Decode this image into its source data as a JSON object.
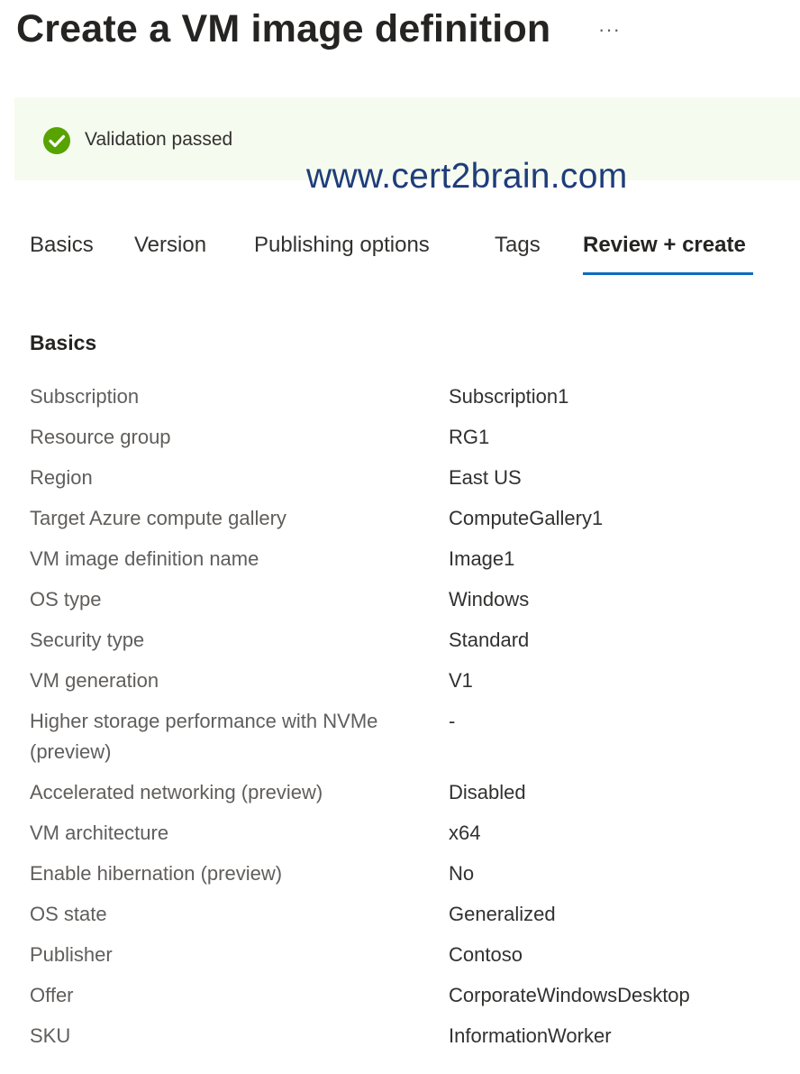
{
  "header": {
    "title": "Create a VM image definition",
    "more_label": "···"
  },
  "validation": {
    "icon": "check-circle-icon",
    "status_color": "#57a300",
    "message": "Validation passed"
  },
  "watermark": "www.cert2brain.com",
  "tabs": [
    {
      "label": "Basics"
    },
    {
      "label": "Version"
    },
    {
      "label": "Publishing options"
    },
    {
      "label": "Tags"
    },
    {
      "label": "Review + create",
      "active": true
    }
  ],
  "accent_color": "#0f6cbd",
  "summary": {
    "heading": "Basics",
    "rows": [
      {
        "label": "Subscription",
        "value": "Subscription1"
      },
      {
        "label": "Resource group",
        "value": "RG1"
      },
      {
        "label": "Region",
        "value": "East US"
      },
      {
        "label": "Target Azure compute gallery",
        "value": "ComputeGallery1"
      },
      {
        "label": "VM image definition name",
        "value": "Image1"
      },
      {
        "label": "OS type",
        "value": "Windows"
      },
      {
        "label": "Security type",
        "value": "Standard"
      },
      {
        "label": "VM generation",
        "value": "V1"
      },
      {
        "label": "Higher storage performance with NVMe (preview)",
        "value": "-"
      },
      {
        "label": "Accelerated networking (preview)",
        "value": "Disabled"
      },
      {
        "label": "VM architecture",
        "value": "x64"
      },
      {
        "label": "Enable hibernation (preview)",
        "value": "No"
      },
      {
        "label": "OS state",
        "value": "Generalized"
      },
      {
        "label": "Publisher",
        "value": "Contoso"
      },
      {
        "label": "Offer",
        "value": "CorporateWindowsDesktop"
      },
      {
        "label": "SKU",
        "value": "InformationWorker"
      }
    ]
  }
}
